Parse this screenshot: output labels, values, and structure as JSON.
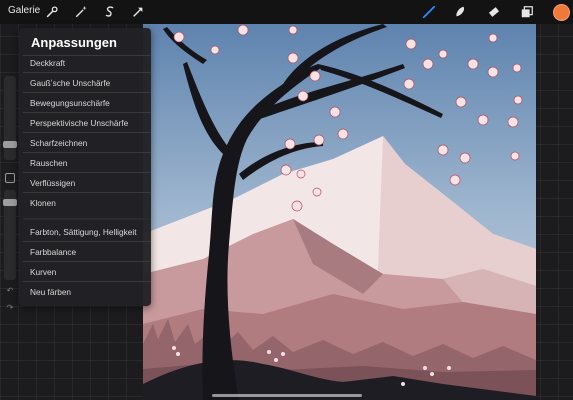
{
  "topbar": {
    "gallery_label": "Galerie",
    "tools_left": [
      "wrench-icon",
      "magic-wand-icon",
      "selection-icon",
      "transform-arrow-icon"
    ],
    "tools_right": [
      "brush-icon",
      "smudge-icon",
      "eraser-icon",
      "layers-icon"
    ],
    "active_tool": "brush-icon",
    "active_color": "#f0793a"
  },
  "adjustments_panel": {
    "title": "Anpassungen",
    "group1": [
      "Deckkraft",
      "Gaußʼsche Unschärfe",
      "Bewegungsunschärfe",
      "Perspektivische Unschärfe",
      "Scharfzeichnen",
      "Rauschen",
      "Verflüssigen",
      "Klonen"
    ],
    "group2": [
      "Farbton, Sättigung, Helligkeit",
      "Farbbalance",
      "Kurven",
      "Neu färben"
    ]
  },
  "colors": {
    "accent_blue": "#2f8cff",
    "brush_color": "#f0793a"
  }
}
